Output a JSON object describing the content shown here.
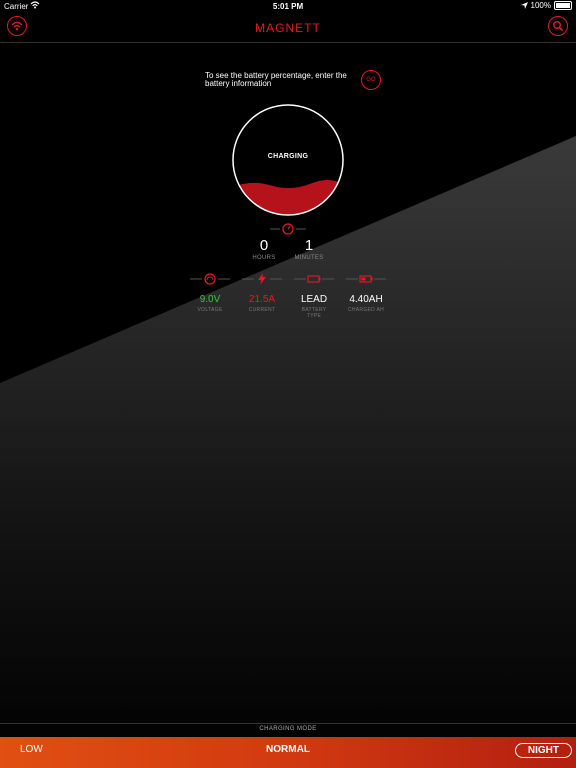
{
  "status_bar": {
    "carrier": "Carrier",
    "time": "5:01 PM",
    "battery": "100%"
  },
  "nav": {
    "title": "MAGNETT",
    "left_icon": "wifi-icon",
    "right_icon": "search-icon"
  },
  "hint": {
    "text": "To see the battery percentage, enter the battery information",
    "go_label": "GO"
  },
  "gauge": {
    "status": "CHARGING",
    "level_fraction": 0.25,
    "fill_color": "#b5121b"
  },
  "timer": {
    "hours": {
      "value": "0",
      "label": "HOURS"
    },
    "minutes": {
      "value": "1",
      "label": "MINUTES"
    }
  },
  "stats": [
    {
      "value": "9.0V",
      "label": "VOLTAGE",
      "color": "#3fbf3f",
      "icon": "voltage-gauge-icon"
    },
    {
      "value": "21.5A",
      "label": "CURRENT",
      "color": "#e31b23",
      "icon": "lightning-icon"
    },
    {
      "value": "LEAD",
      "label": "BATTERY TYPE",
      "color": "#ffffff",
      "icon": "battery-icon"
    },
    {
      "value": "4.40AH",
      "label": "CHARGED AH",
      "color": "#ffffff",
      "icon": "battery-charged-icon"
    }
  ],
  "mode": {
    "label": "CHARGING MODE",
    "options": {
      "low": "LOW",
      "normal": "NORMAL",
      "night": "NIGHT"
    },
    "selected": "NIGHT"
  },
  "colors": {
    "accent": "#e31b23",
    "modebar_start": "#e14f12",
    "modebar_end": "#b21f10"
  }
}
